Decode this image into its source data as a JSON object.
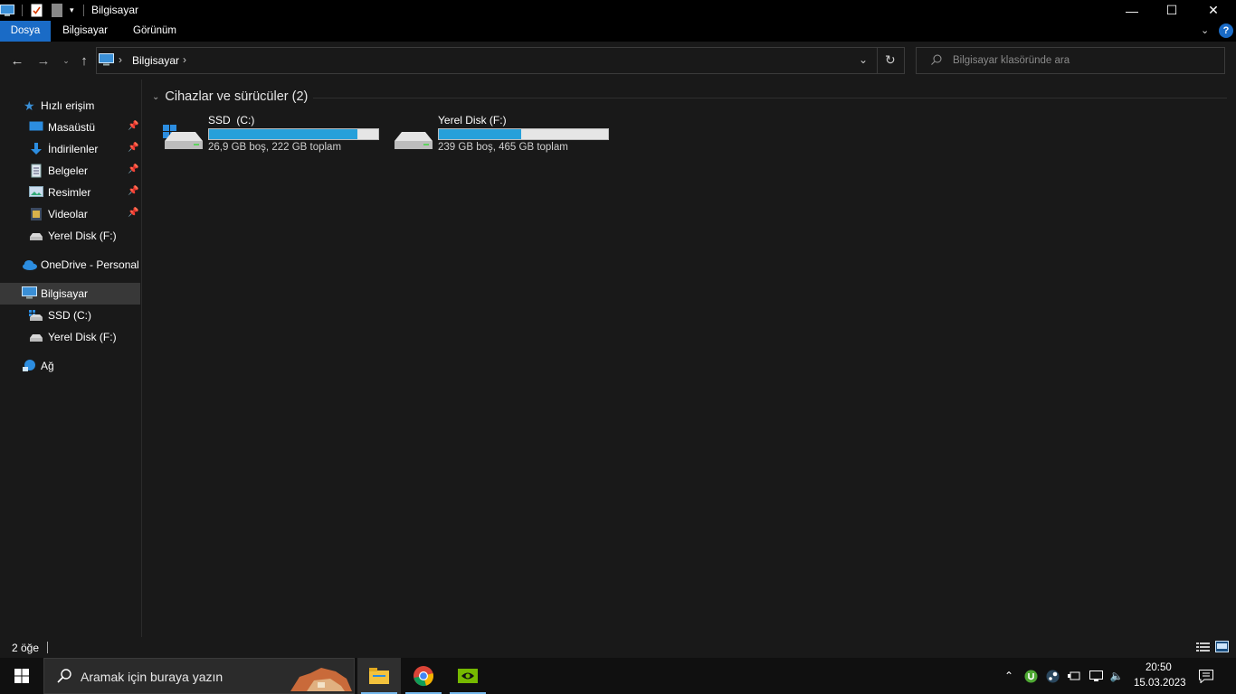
{
  "window": {
    "title": "Bilgisayar",
    "controls": {
      "minimize": "—",
      "maximize": "☐",
      "close": "✕"
    }
  },
  "ribbon": {
    "tabs": [
      {
        "label": "Dosya",
        "active": true
      },
      {
        "label": "Bilgisayar",
        "active": false
      },
      {
        "label": "Görünüm",
        "active": false
      }
    ],
    "help": "?"
  },
  "address": {
    "path": "Bilgisayar",
    "separator": "›",
    "search_placeholder": "Bilgisayar klasöründe ara"
  },
  "sidebar": {
    "items": [
      {
        "label": "Hızlı erişim",
        "icon": "star-icon",
        "pinned": false
      },
      {
        "label": "Masaüstü",
        "icon": "desktop-icon",
        "pinned": true
      },
      {
        "label": "İndirilenler",
        "icon": "download-icon",
        "pinned": true
      },
      {
        "label": "Belgeler",
        "icon": "documents-icon",
        "pinned": true
      },
      {
        "label": "Resimler",
        "icon": "pictures-icon",
        "pinned": true
      },
      {
        "label": "Videolar",
        "icon": "videos-icon",
        "pinned": true
      },
      {
        "label": "Yerel Disk (F:)",
        "icon": "drive-icon",
        "pinned": false
      },
      {
        "label": "OneDrive - Personal",
        "icon": "cloud-icon",
        "pinned": false
      },
      {
        "label": "Bilgisayar",
        "icon": "computer-icon",
        "selected": true
      },
      {
        "label": "SSD  (C:)",
        "icon": "system-drive-icon",
        "pinned": false
      },
      {
        "label": "Yerel Disk (F:)",
        "icon": "drive-icon",
        "pinned": false
      },
      {
        "label": "Ağ",
        "icon": "network-icon",
        "pinned": false
      }
    ],
    "pin_glyph": "📌"
  },
  "main": {
    "group_title": "Cihazlar ve sürücüler (2)",
    "drives": [
      {
        "name": "SSD  (C:)",
        "info": "26,9 GB boş, 222 GB toplam",
        "used_fraction": 0.879
      },
      {
        "name": "Yerel Disk (F:)",
        "info": "239 GB boş, 465 GB toplam",
        "used_fraction": 0.486
      }
    ]
  },
  "status": {
    "item_count": "2 öğe"
  },
  "taskbar": {
    "search_placeholder": "Aramak için buraya yazın",
    "apps": [
      "file-explorer",
      "chrome",
      "nvidia"
    ],
    "clock_time": "20:50",
    "clock_date": "15.03.2023"
  },
  "colors": {
    "accent": "#1a6bc6",
    "drive_bar": "#26a0da",
    "background": "#191919"
  }
}
